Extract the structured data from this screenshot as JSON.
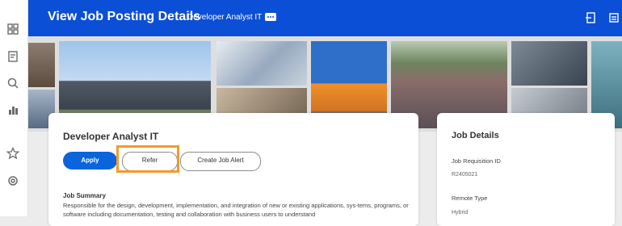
{
  "header": {
    "title": "View Job Posting Details",
    "subtitle": "Developer Analyst IT"
  },
  "rail": {
    "icons": [
      "dashboard-icon",
      "report-icon",
      "search-icon",
      "org-chart-icon",
      "star-icon",
      "settings-icon"
    ]
  },
  "job": {
    "title": "Developer Analyst IT",
    "buttons": {
      "apply": "Apply",
      "refer": "Refer",
      "create_alert": "Create Job Alert"
    },
    "summary_heading": "Job Summary",
    "summary_text": "Responsible for the design, development, implementation, and integration of new or existing applications, sys-tems, programs, or software including documentation, testing and collaboration with business users to understand"
  },
  "details": {
    "heading": "Job Details",
    "requisition_label": "Job Requisition ID",
    "requisition_value": "R2405021",
    "remote_label": "Remote Type",
    "remote_value": "Hybrid"
  },
  "colors": {
    "brand": "#0b4fd6",
    "apply": "#0b64dc",
    "highlight": "#f29a2e"
  }
}
